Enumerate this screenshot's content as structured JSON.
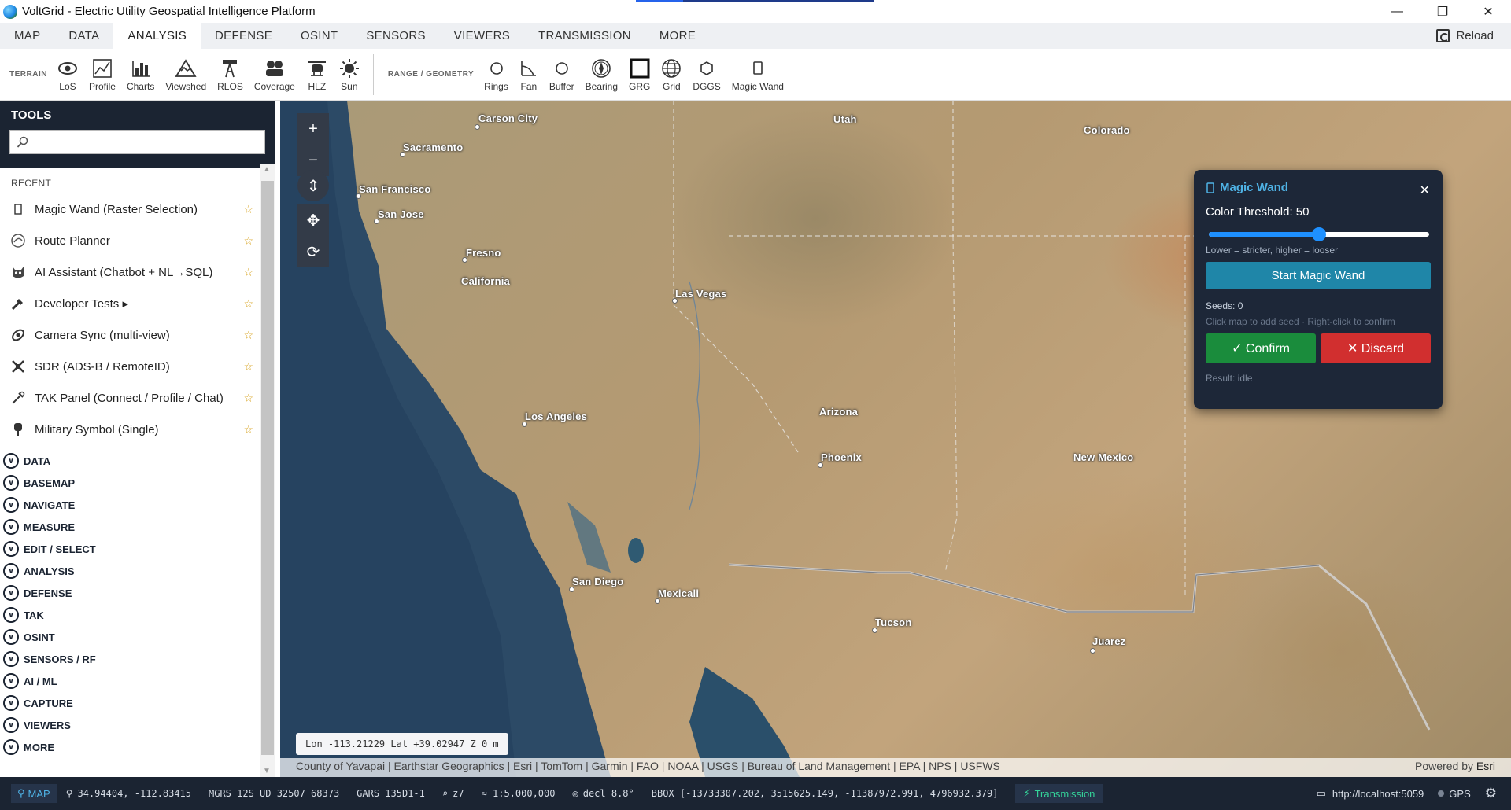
{
  "window": {
    "title": "VoltGrid - Electric Utility Geospatial Intelligence Platform",
    "minimize": "—",
    "restore": "❐",
    "close": "✕"
  },
  "menu": {
    "tabs": [
      "MAP",
      "DATA",
      "ANALYSIS",
      "DEFENSE",
      "OSINT",
      "SENSORS",
      "VIEWERS",
      "TRANSMISSION",
      "MORE"
    ],
    "active": "ANALYSIS",
    "reload": "Reload"
  },
  "ribbon": {
    "terrain_label": "TERRAIN",
    "terrain_tools": [
      "LoS",
      "Profile",
      "Charts",
      "Viewshed",
      "RLOS",
      "Coverage",
      "HLZ",
      "Sun"
    ],
    "range_label": "RANGE / GEOMETRY",
    "range_tools": [
      "Rings",
      "Fan",
      "Buffer",
      "Bearing",
      "GRG",
      "Grid",
      "DGGS",
      "Magic Wand"
    ]
  },
  "sidebar": {
    "header": "TOOLS",
    "search_placeholder": "",
    "recent_label": "RECENT",
    "recent": [
      {
        "label": "Magic Wand (Raster Selection)",
        "icon": "rect-icon",
        "star": "☆"
      },
      {
        "label": "Route Planner",
        "icon": "route-icon",
        "star": "☆"
      },
      {
        "label": "AI Assistant (Chatbot + NL→SQL)",
        "icon": "bot-icon",
        "star": "☆"
      },
      {
        "label": "Developer Tests  ▸",
        "icon": "wrench-icon",
        "star": "☆"
      },
      {
        "label": "Camera Sync (multi-view)",
        "icon": "link-icon",
        "star": "☆"
      },
      {
        "label": "SDR (ADS-B / RemoteID)",
        "icon": "satellite-icon",
        "star": "☆"
      },
      {
        "label": "TAK Panel (Connect / Profile / Chat)",
        "icon": "tak-icon",
        "star": "☆"
      },
      {
        "label": "Military Symbol (Single)",
        "icon": "symbol-icon",
        "star": "☆"
      }
    ],
    "categories": [
      "DATA",
      "BASEMAP",
      "NAVIGATE",
      "MEASURE",
      "EDIT / SELECT",
      "ANALYSIS",
      "DEFENSE",
      "TAK",
      "OSINT",
      "SENSORS / RF",
      "AI / ML",
      "CAPTURE",
      "VIEWERS",
      "MORE"
    ]
  },
  "map": {
    "places": [
      "Carson City",
      "Sacramento",
      "San Francisco",
      "San Jose",
      "Fresno",
      "California",
      "Las Vegas",
      "Utah",
      "Colorado",
      "Los Angeles",
      "Arizona",
      "Phoenix",
      "San Diego",
      "Mexicali",
      "Tucson",
      "New Mexico",
      "Juarez"
    ],
    "coord_readout": "Lon -113.21229   Lat +39.02947   Z 0 m",
    "attribution": "County of Yavapai | Earthstar Geographics | Esri | TomTom | Garmin | FAO | NOAA | USGS | Bureau of Land Management | EPA | NPS | USFWS",
    "powered_by": "Powered by",
    "powered_link": "Esri"
  },
  "magic_wand": {
    "title": "Magic Wand",
    "close": "✕",
    "threshold_label": "Color Threshold: 50",
    "threshold": 50,
    "threshold_max": 100,
    "threshold_hint": "Lower = stricter, higher = looser",
    "start_button": "Start Magic Wand",
    "seeds": "Seeds: 0",
    "instructions": "Click map to add seed · Right-click to confirm",
    "confirm": "✓ Confirm",
    "discard": "✕ Discard",
    "result": "Result: idle"
  },
  "status": {
    "mode": "MAP",
    "latlon": "34.94404, -112.83415",
    "mgrs": "MGRS 12S UD 32507 68373",
    "gars": "GARS 135D1-1",
    "zoom": "z7",
    "scale": "≈ 1:5,000,000",
    "decl": "decl 8.8°",
    "bbox": "BBOX [-13733307.202, 3515625.149, -11387972.991, 4796932.379]",
    "transmission": "Transmission",
    "server": "http://localhost:5059",
    "gps": "GPS"
  },
  "colors": {
    "accent": "#4fb3e6",
    "dark": "#1b2432",
    "confirm": "#1a8c3c",
    "discard": "#d12f2f",
    "start": "#1f86a8"
  }
}
